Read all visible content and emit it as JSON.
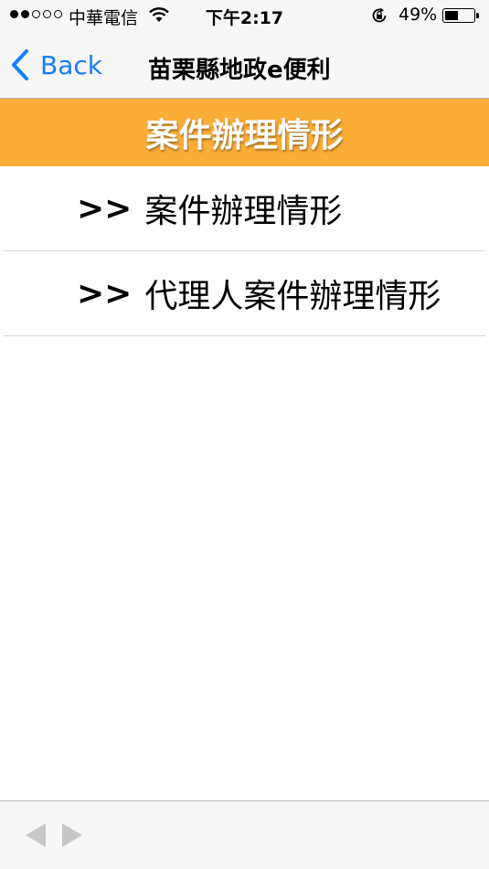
{
  "status_bar": {
    "carrier": "中華電信",
    "time": "下午2:17",
    "battery_percent": "49%",
    "battery_level": 0.49,
    "signal_bars_filled": 2,
    "signal_bars_total": 5
  },
  "nav_bar": {
    "back_label": "Back",
    "title": "苗栗縣地政e便利"
  },
  "section_header": {
    "title": "案件辦理情形"
  },
  "menu": {
    "arrow": ">>",
    "items": [
      {
        "label": "案件辦理情形"
      },
      {
        "label": "代理人案件辦理情形"
      }
    ]
  },
  "colors": {
    "accent": "#157efb",
    "header_bg": "#fcad37",
    "disabled": "#c7c7c7"
  },
  "icons": {
    "wifi": "wifi-icon",
    "rotation_lock": "rotation-lock-icon",
    "battery": "battery-icon",
    "back": "chevron-left-icon",
    "toolbar_back": "arrow-left-icon",
    "toolbar_forward": "arrow-right-icon"
  }
}
